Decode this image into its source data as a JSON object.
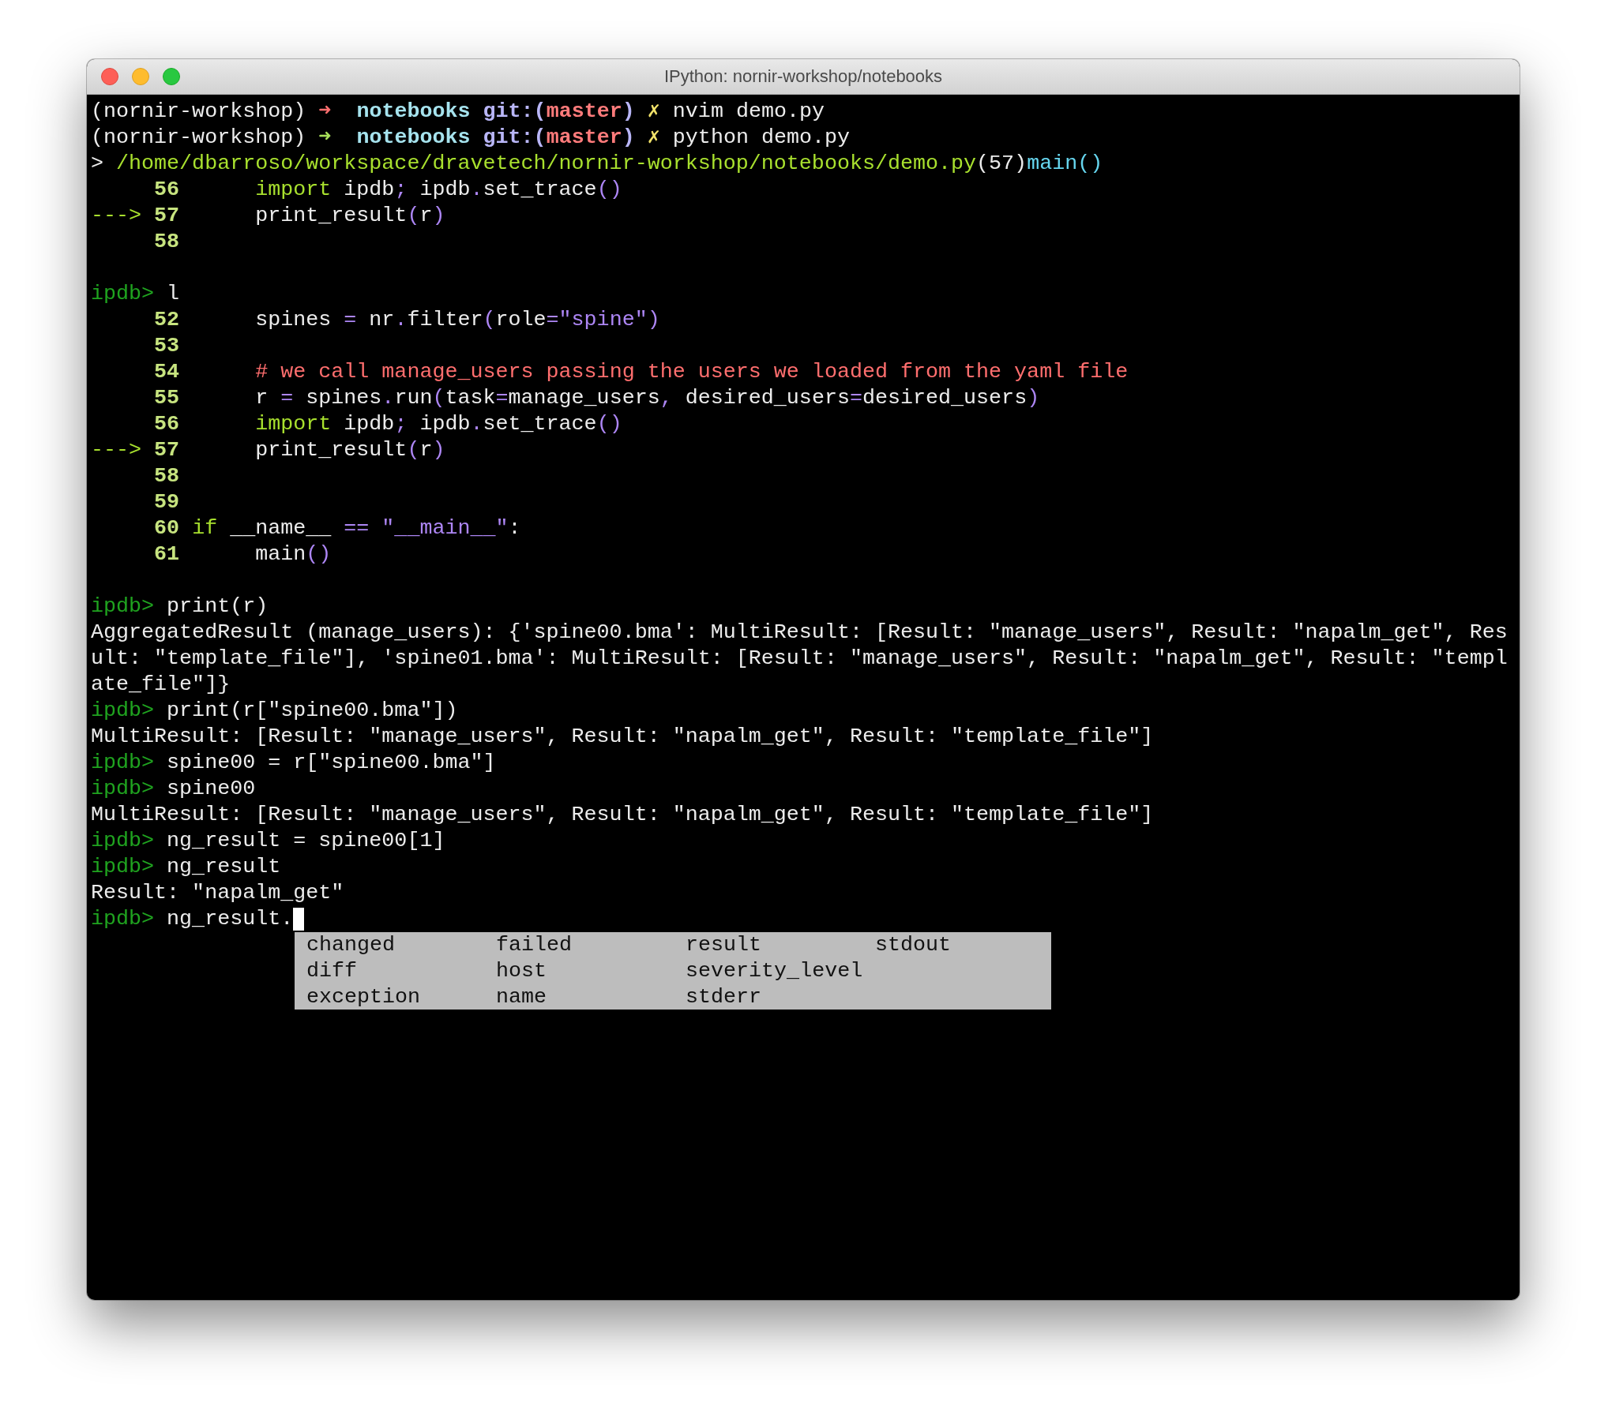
{
  "window": {
    "title": "IPython: nornir-workshop/notebooks"
  },
  "terminal": {
    "cursor": true,
    "blocks": [
      {
        "lines": [
          {
            "segments": [
              {
                "text": "(nornir-workshop) ",
                "kind": "plain"
              },
              {
                "text": "➜  ",
                "kind": "arrow-err"
              },
              {
                "text": "notebooks",
                "kind": "dir"
              },
              {
                "text": " git:(",
                "kind": "git"
              },
              {
                "text": "master",
                "kind": "branch"
              },
              {
                "text": ")",
                "kind": "git"
              },
              {
                "text": " ✗",
                "kind": "dirty"
              },
              {
                "text": " nvim demo.py",
                "kind": "plain"
              }
            ]
          },
          {
            "segments": [
              {
                "text": "(nornir-workshop) ",
                "kind": "plain"
              },
              {
                "text": "➜  ",
                "kind": "arrow-ok"
              },
              {
                "text": "notebooks",
                "kind": "dir"
              },
              {
                "text": " git:(",
                "kind": "git"
              },
              {
                "text": "master",
                "kind": "branch"
              },
              {
                "text": ")",
                "kind": "git"
              },
              {
                "text": " ✗",
                "kind": "dirty"
              },
              {
                "text": " python demo.py",
                "kind": "plain"
              }
            ]
          },
          {
            "segments": [
              {
                "text": "> ",
                "kind": "plain"
              },
              {
                "text": "/home/dbarroso/workspace/dravetech/nornir-workshop/notebooks/demo.py",
                "kind": "path"
              },
              {
                "text": "(57)",
                "kind": "plain"
              },
              {
                "text": "main()",
                "kind": "func"
              }
            ]
          },
          {
            "segments": [
              {
                "text": "     56      ",
                "kind": "lineno"
              },
              {
                "text": "import",
                "kind": "keyword"
              },
              {
                "text": " ipdb",
                "kind": "plain"
              },
              {
                "text": ";",
                "kind": "punct"
              },
              {
                "text": " ipdb",
                "kind": "plain"
              },
              {
                "text": ".",
                "kind": "punct"
              },
              {
                "text": "set_trace",
                "kind": "plain"
              },
              {
                "text": "()",
                "kind": "punct"
              }
            ]
          },
          {
            "segments": [
              {
                "text": "---> ",
                "kind": "marker"
              },
              {
                "text": "57",
                "kind": "lineno"
              },
              {
                "text": "      print_result",
                "kind": "plain"
              },
              {
                "text": "(",
                "kind": "punct"
              },
              {
                "text": "r",
                "kind": "plain"
              },
              {
                "text": ")",
                "kind": "punct"
              }
            ]
          },
          {
            "segments": [
              {
                "text": "     58",
                "kind": "lineno"
              }
            ]
          }
        ]
      },
      {
        "lines": [
          {
            "segments": [
              {
                "text": "ipdb> ",
                "kind": "ipdb"
              },
              {
                "text": "l",
                "kind": "plain"
              }
            ]
          },
          {
            "segments": [
              {
                "text": "     52",
                "kind": "lineno"
              },
              {
                "text": "      spines ",
                "kind": "plain"
              },
              {
                "text": "=",
                "kind": "punct"
              },
              {
                "text": " nr",
                "kind": "plain"
              },
              {
                "text": ".",
                "kind": "punct"
              },
              {
                "text": "filter",
                "kind": "plain"
              },
              {
                "text": "(",
                "kind": "punct"
              },
              {
                "text": "role",
                "kind": "plain"
              },
              {
                "text": "=\"spine\")",
                "kind": "punct"
              }
            ]
          },
          {
            "segments": [
              {
                "text": "     53",
                "kind": "lineno"
              }
            ]
          },
          {
            "segments": [
              {
                "text": "     54      ",
                "kind": "lineno"
              },
              {
                "text": "# we call manage_users passing the users we loaded from the yaml file",
                "kind": "comment"
              }
            ]
          },
          {
            "segments": [
              {
                "text": "     55",
                "kind": "lineno"
              },
              {
                "text": "      r ",
                "kind": "plain"
              },
              {
                "text": "=",
                "kind": "punct"
              },
              {
                "text": " spines",
                "kind": "plain"
              },
              {
                "text": ".",
                "kind": "punct"
              },
              {
                "text": "run",
                "kind": "plain"
              },
              {
                "text": "(",
                "kind": "punct"
              },
              {
                "text": "task",
                "kind": "plain"
              },
              {
                "text": "=",
                "kind": "punct"
              },
              {
                "text": "manage_users",
                "kind": "plain"
              },
              {
                "text": ",",
                "kind": "punct"
              },
              {
                "text": " desired_users",
                "kind": "plain"
              },
              {
                "text": "=",
                "kind": "punct"
              },
              {
                "text": "desired_users",
                "kind": "plain"
              },
              {
                "text": ")",
                "kind": "punct"
              }
            ]
          },
          {
            "segments": [
              {
                "text": "     56      ",
                "kind": "lineno"
              },
              {
                "text": "import",
                "kind": "keyword"
              },
              {
                "text": " ipdb",
                "kind": "plain"
              },
              {
                "text": ";",
                "kind": "punct"
              },
              {
                "text": " ipdb",
                "kind": "plain"
              },
              {
                "text": ".",
                "kind": "punct"
              },
              {
                "text": "set_trace",
                "kind": "plain"
              },
              {
                "text": "()",
                "kind": "punct"
              }
            ]
          },
          {
            "segments": [
              {
                "text": "---> ",
                "kind": "marker"
              },
              {
                "text": "57",
                "kind": "lineno"
              },
              {
                "text": "      print_result",
                "kind": "plain"
              },
              {
                "text": "(",
                "kind": "punct"
              },
              {
                "text": "r",
                "kind": "plain"
              },
              {
                "text": ")",
                "kind": "punct"
              }
            ]
          },
          {
            "segments": [
              {
                "text": "     58",
                "kind": "lineno"
              }
            ]
          },
          {
            "segments": [
              {
                "text": "     59",
                "kind": "lineno"
              }
            ]
          },
          {
            "segments": [
              {
                "text": "     60 ",
                "kind": "lineno"
              },
              {
                "text": "if",
                "kind": "keyword"
              },
              {
                "text": " __name__ ",
                "kind": "plain"
              },
              {
                "text": "== \"__main__\"",
                "kind": "punct"
              },
              {
                "text": ":",
                "kind": "plain"
              }
            ]
          },
          {
            "segments": [
              {
                "text": "     61",
                "kind": "lineno"
              },
              {
                "text": "      main",
                "kind": "plain"
              },
              {
                "text": "()",
                "kind": "punct"
              }
            ]
          }
        ]
      },
      {
        "lines": [
          {
            "segments": [
              {
                "text": "ipdb> ",
                "kind": "ipdb"
              },
              {
                "text": "print(r)",
                "kind": "plain"
              }
            ]
          },
          {
            "segments": [
              {
                "text": "AggregatedResult (manage_users): {'spine00.bma': MultiResult: [Result: \"manage_users\", Result: \"napalm_get\", Res",
                "kind": "plain"
              }
            ]
          },
          {
            "segments": [
              {
                "text": "ult: \"template_file\"], 'spine01.bma': MultiResult: [Result: \"manage_users\", Result: \"napalm_get\", Result: \"templ",
                "kind": "plain"
              }
            ]
          },
          {
            "segments": [
              {
                "text": "ate_file\"]}",
                "kind": "plain"
              }
            ]
          },
          {
            "segments": [
              {
                "text": "ipdb> ",
                "kind": "ipdb"
              },
              {
                "text": "print(r[\"spine00.bma\"])",
                "kind": "plain"
              }
            ]
          },
          {
            "segments": [
              {
                "text": "MultiResult: [Result: \"manage_users\", Result: \"napalm_get\", Result: \"template_file\"]",
                "kind": "plain"
              }
            ]
          },
          {
            "segments": [
              {
                "text": "ipdb> ",
                "kind": "ipdb"
              },
              {
                "text": "spine00 = r[\"spine00.bma\"]",
                "kind": "plain"
              }
            ]
          },
          {
            "segments": [
              {
                "text": "ipdb> ",
                "kind": "ipdb"
              },
              {
                "text": "spine00",
                "kind": "plain"
              }
            ]
          },
          {
            "segments": [
              {
                "text": "MultiResult: [Result: \"manage_users\", Result: \"napalm_get\", Result: \"template_file\"]",
                "kind": "plain"
              }
            ]
          },
          {
            "segments": [
              {
                "text": "ipdb> ",
                "kind": "ipdb"
              },
              {
                "text": "ng_result = spine00[1]",
                "kind": "plain"
              }
            ]
          },
          {
            "segments": [
              {
                "text": "ipdb> ",
                "kind": "ipdb"
              },
              {
                "text": "ng_result",
                "kind": "plain"
              }
            ]
          },
          {
            "segments": [
              {
                "text": "Result: \"napalm_get\"",
                "kind": "plain"
              }
            ]
          },
          {
            "segments": [
              {
                "text": "ipdb> ",
                "kind": "ipdb"
              },
              {
                "text": "ng_result.",
                "kind": "plain"
              }
            ]
          }
        ]
      }
    ]
  },
  "completion_menu": {
    "items": [
      "changed",
      "diff",
      "exception",
      "failed",
      "host",
      "name",
      "result",
      "severity_level",
      "stderr",
      "stdout"
    ]
  }
}
